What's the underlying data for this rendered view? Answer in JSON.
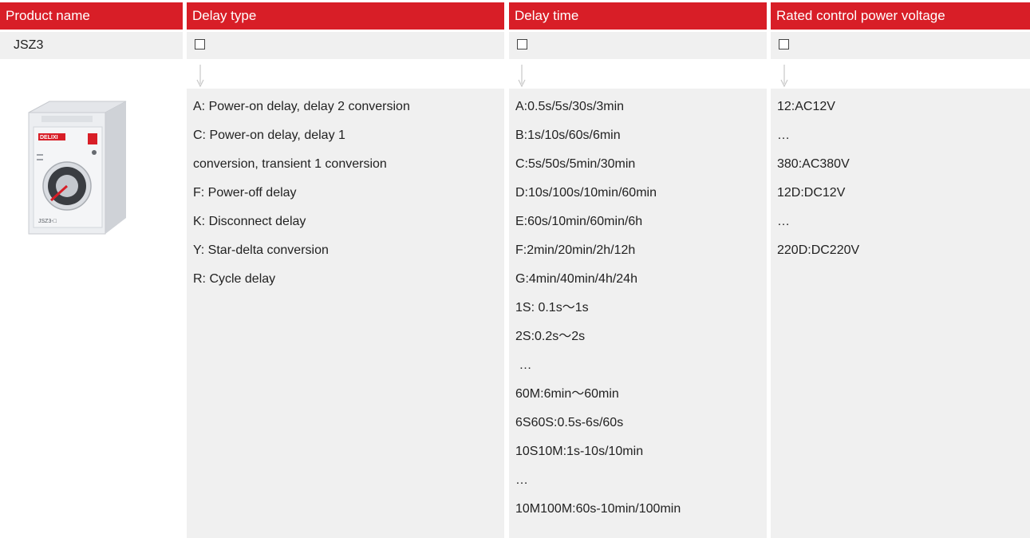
{
  "header": {
    "product_name": "Product name",
    "delay_type": "Delay type",
    "delay_time": "Delay time",
    "rated_voltage": "Rated control power voltage"
  },
  "code_row": {
    "product_code": "JSZ3"
  },
  "product_image": {
    "label_brand": "DELIXI",
    "label_model": "JSZ3-□"
  },
  "delay_types": [
    "A: Power-on delay, delay 2 conversion",
    "C: Power-on delay, delay 1",
    "conversion, transient 1 conversion",
    "F: Power-off delay",
    "K: Disconnect delay",
    "Y: Star-delta conversion",
    "R: Cycle delay"
  ],
  "delay_times": [
    "A:0.5s/5s/30s/3min",
    "B:1s/10s/60s/6min",
    "C:5s/50s/5min/30min",
    "D:10s/100s/10min/60min",
    "E:60s/10min/60min/6h",
    "F:2min/20min/2h/12h",
    "G:4min/40min/4h/24h",
    "1S: 0.1s～1s",
    "2S:0.2s～2s",
    " …",
    "60M:6min～60min",
    "6S60S:0.5s-6s/60s",
    "10S10M:1s-10s/10min",
    "…",
    "10M100M:60s-10min/100min"
  ],
  "voltages": [
    "12:AC12V",
    "…",
    "380:AC380V",
    "12D:DC12V",
    "…",
    "220D:DC220V"
  ],
  "colors": {
    "header_bg": "#d81e27",
    "header_text": "#ffffff",
    "panel_bg": "#f0f0f0",
    "text": "#222222"
  }
}
